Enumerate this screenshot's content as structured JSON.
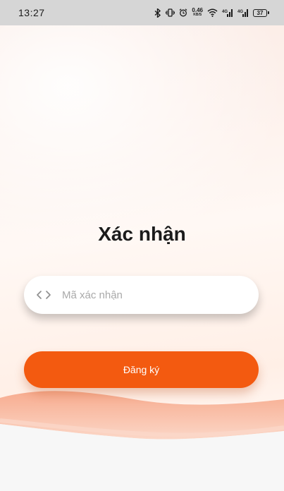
{
  "status_bar": {
    "time": "13:27",
    "net_speed_value": "0.46",
    "net_speed_unit": "KB/S",
    "battery_level": "37",
    "signal_1_label": "4G",
    "signal_2_label": "4G"
  },
  "page": {
    "title": "Xác nhận"
  },
  "form": {
    "code_placeholder": "Mã xác nhận",
    "code_value": "",
    "submit_label": "Đăng ký"
  },
  "colors": {
    "accent": "#f35a10",
    "status_bar_bg": "#d6d6d6"
  },
  "icons": {
    "code_field": "code-brackets-icon",
    "status": [
      "bluetooth-icon",
      "vibrate-icon",
      "alarm-icon",
      "wifi-icon",
      "signal-icon",
      "signal-icon",
      "battery-icon"
    ]
  }
}
